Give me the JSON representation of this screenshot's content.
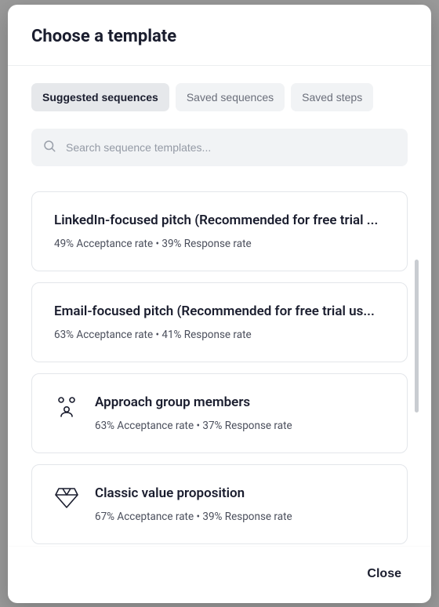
{
  "modal": {
    "title": "Choose a template",
    "close_label": "Close"
  },
  "tabs": [
    {
      "label": "Suggested sequences",
      "active": true
    },
    {
      "label": "Saved sequences",
      "active": false
    },
    {
      "label": "Saved steps",
      "active": false
    }
  ],
  "search": {
    "placeholder": "Search sequence templates...",
    "value": ""
  },
  "templates": [
    {
      "title": "LinkedIn-focused pitch (Recommended for free trial ...",
      "stats": "49% Acceptance rate • 39% Response rate",
      "icon": null
    },
    {
      "title": "Email-focused pitch (Recommended for free trial us...",
      "stats": "63% Acceptance rate • 41% Response rate",
      "icon": null
    },
    {
      "title": "Approach group members",
      "stats": "63% Acceptance rate • 37% Response rate",
      "icon": "group"
    },
    {
      "title": "Classic value proposition",
      "stats": "67% Acceptance rate • 39% Response rate",
      "icon": "diamond"
    }
  ]
}
